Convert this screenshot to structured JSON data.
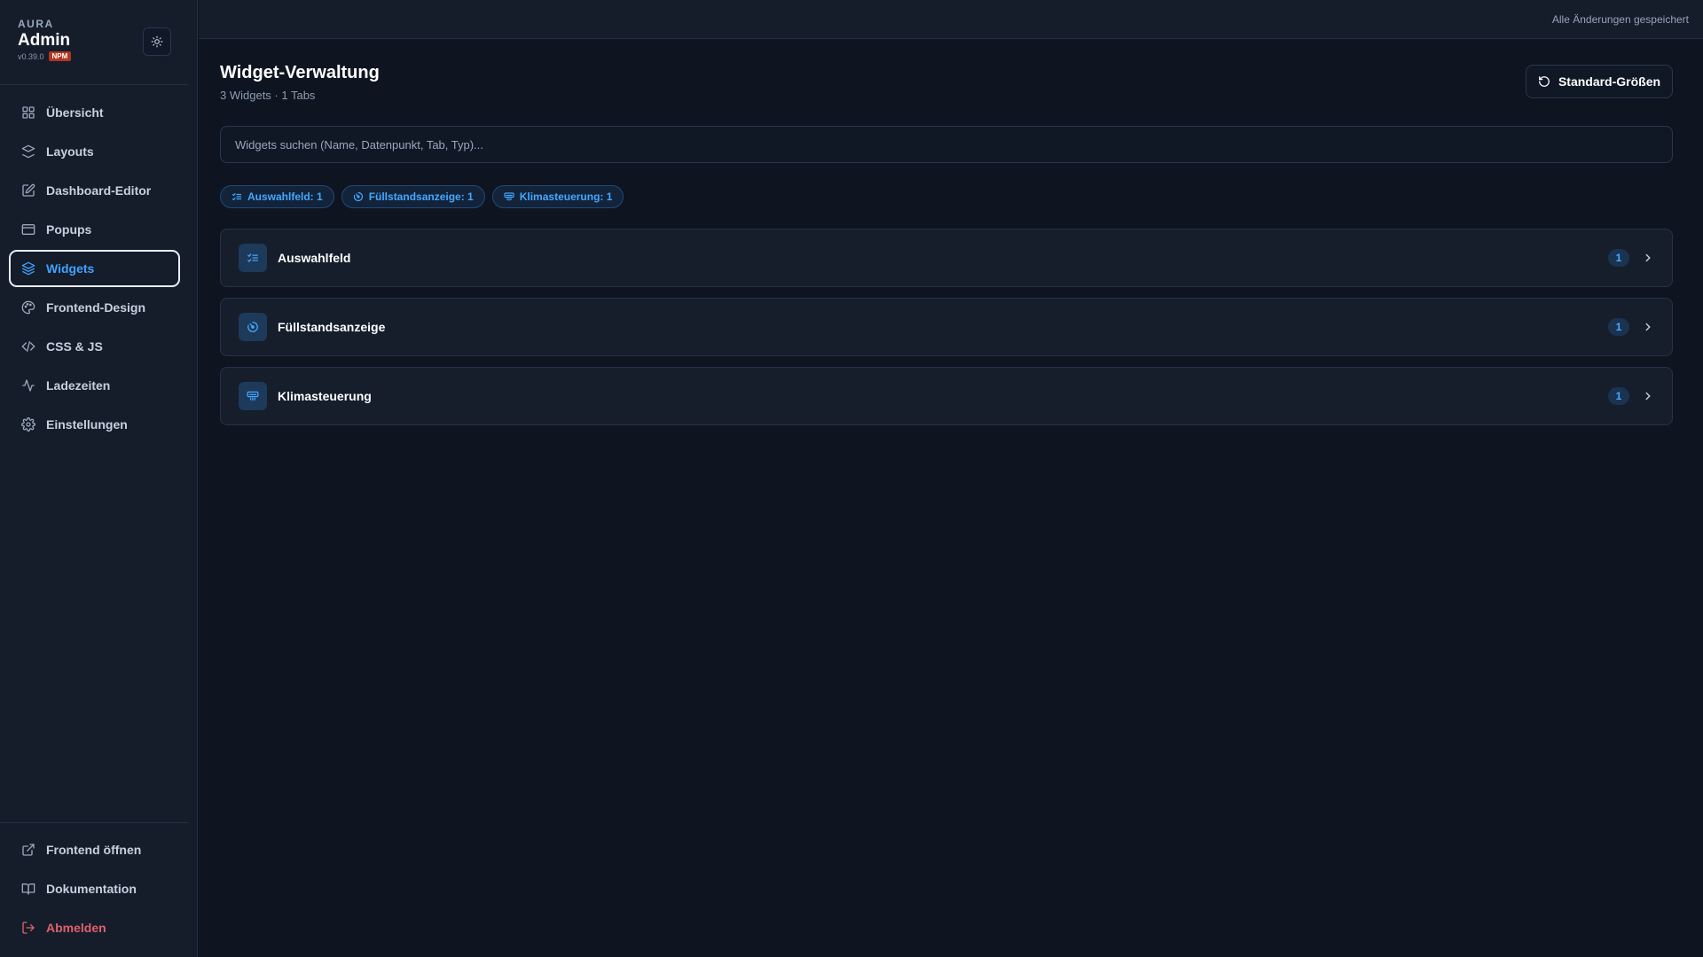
{
  "brand": {
    "small": "AURA",
    "title": "Admin",
    "version": "v0.39.0",
    "badge": "NPM"
  },
  "sidebar": {
    "items": [
      {
        "label": "Übersicht",
        "icon": "grid-icon"
      },
      {
        "label": "Layouts",
        "icon": "layers-icon"
      },
      {
        "label": "Dashboard-Editor",
        "icon": "edit-icon"
      },
      {
        "label": "Popups",
        "icon": "window-icon"
      },
      {
        "label": "Widgets",
        "icon": "stack-icon",
        "active": true
      },
      {
        "label": "Frontend-Design",
        "icon": "palette-icon"
      },
      {
        "label": "CSS & JS",
        "icon": "code-icon"
      },
      {
        "label": "Ladezeiten",
        "icon": "activity-icon"
      },
      {
        "label": "Einstellungen",
        "icon": "gear-icon"
      }
    ],
    "bottom": [
      {
        "label": "Frontend öffnen",
        "icon": "external-link-icon"
      },
      {
        "label": "Dokumentation",
        "icon": "book-icon"
      },
      {
        "label": "Abmelden",
        "icon": "logout-icon"
      }
    ]
  },
  "topbar": {
    "status": "Alle Änderungen gespeichert"
  },
  "main": {
    "title": "Widget-Verwaltung",
    "subtitle": "3 Widgets · 1 Tabs",
    "reset_label": "Standard-Größen",
    "search_placeholder": "Widgets suchen (Name, Datenpunkt, Tab, Typ)...",
    "chips": [
      {
        "label": "Auswahlfeld: 1",
        "icon": "list-check-icon"
      },
      {
        "label": "Füllstandsanzeige: 1",
        "icon": "gauge-icon"
      },
      {
        "label": "Klimasteuerung: 1",
        "icon": "climate-icon"
      }
    ],
    "widgets": [
      {
        "name": "Auswahlfeld",
        "count": "1",
        "icon": "list-check-icon"
      },
      {
        "name": "Füllstandsanzeige",
        "count": "1",
        "icon": "gauge-icon"
      },
      {
        "name": "Klimasteuerung",
        "count": "1",
        "icon": "climate-icon"
      }
    ]
  },
  "colors": {
    "accent": "#3fa2ff",
    "background": "#0e1420",
    "sidebar": "#151d2b",
    "danger": "#e0606a",
    "npm_badge": "#b3351f"
  }
}
